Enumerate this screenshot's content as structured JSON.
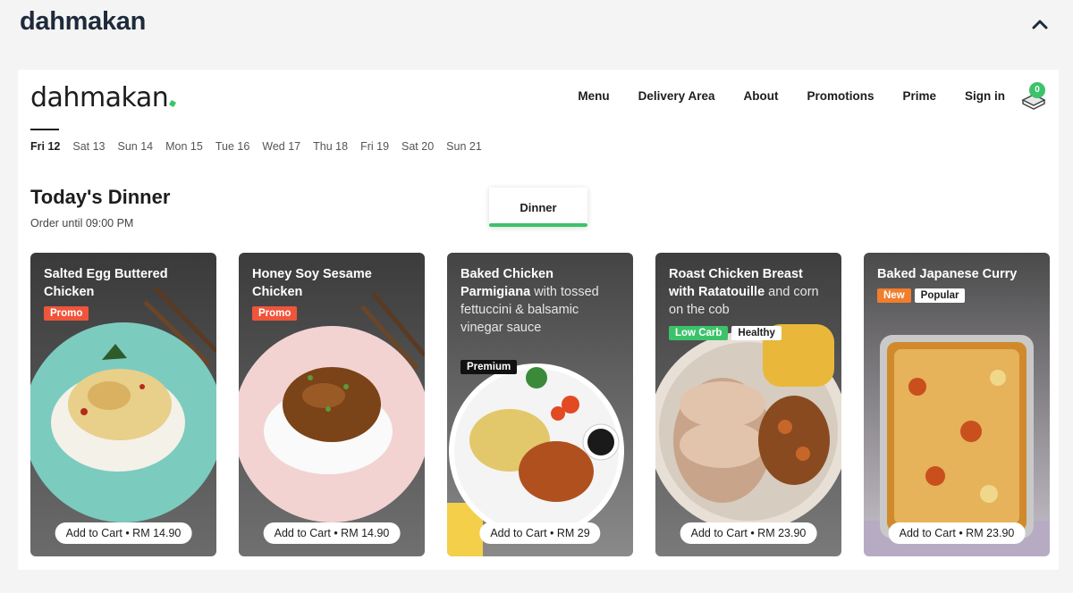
{
  "outer": {
    "title": "dahmakan"
  },
  "nav": {
    "brand": "dahmakan",
    "links": [
      "Menu",
      "Delivery Area",
      "About",
      "Promotions",
      "Prime",
      "Sign in"
    ],
    "cart_count": "0"
  },
  "dates": [
    "Fri 12",
    "Sat 13",
    "Sun 14",
    "Mon 15",
    "Tue 16",
    "Wed 17",
    "Thu 18",
    "Fri 19",
    "Sat 20",
    "Sun 21"
  ],
  "selected_date": "Fri 12",
  "section": {
    "title": "Today's Dinner",
    "subtitle": "Order until 09:00 PM"
  },
  "meal_tab": "Dinner",
  "cards": [
    {
      "name": "Salted Egg Buttered Chicken",
      "desc": "",
      "badges": [
        "Promo"
      ],
      "cta": "Add to Cart • RM 14.90"
    },
    {
      "name": "Honey Soy Sesame Chicken",
      "desc": "",
      "badges": [
        "Promo"
      ],
      "cta": "Add to Cart • RM 14.90"
    },
    {
      "name": "Baked Chicken Parmigiana",
      "desc": " with tossed fettuccini & balsamic vinegar sauce",
      "badges": [
        "Premium"
      ],
      "cta": "Add to Cart • RM 29"
    },
    {
      "name": "Roast Chicken Breast with Ratatouille",
      "desc": " and corn on the cob",
      "badges": [
        "Low Carb",
        "Healthy"
      ],
      "cta": "Add to Cart • RM 23.90"
    },
    {
      "name": "Baked Japanese Curry",
      "desc": "",
      "badges": [
        "New",
        "Popular"
      ],
      "cta": "Add to Cart • RM 23.90"
    }
  ],
  "colors": {
    "accent": "#3cc36a",
    "promo": "#f0553b",
    "new": "#f07e2c",
    "title": "#1e2a3b"
  },
  "icons": {
    "collapse": "chevron-up-icon",
    "cart": "cart-icon"
  }
}
